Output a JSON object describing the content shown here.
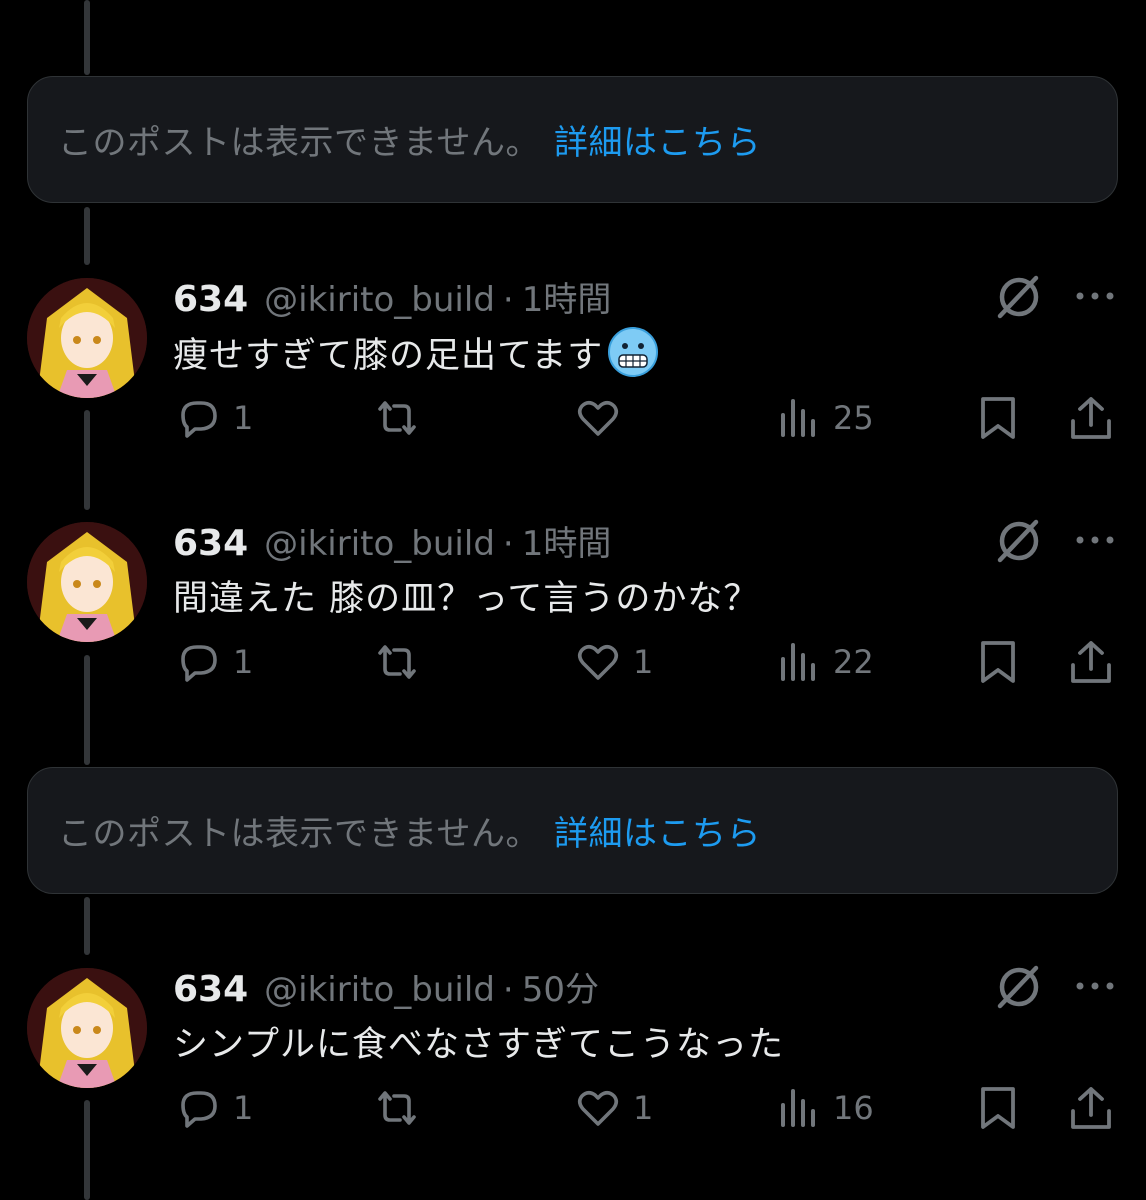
{
  "hidden_notice": {
    "text": "このポストは表示できません。",
    "link": "詳細はこちら"
  },
  "posts": [
    {
      "name": "634",
      "handle": "@ikirito_build",
      "separator": "·",
      "time": "1時間",
      "text": "痩せすぎて膝の足出てます",
      "emoji": "cold-face-emoji",
      "replies": "1",
      "reposts": "",
      "likes": "",
      "views": "25"
    },
    {
      "name": "634",
      "handle": "@ikirito_build",
      "separator": "·",
      "time": "1時間",
      "text": "間違えた 膝の皿？って言うのかな？",
      "replies": "1",
      "reposts": "",
      "likes": "1",
      "views": "22"
    },
    {
      "name": "634",
      "handle": "@ikirito_build",
      "separator": "·",
      "time": "50分",
      "text": "シンプルに食べなさすぎてこうなった",
      "replies": "1",
      "reposts": "",
      "likes": "1",
      "views": "16"
    }
  ],
  "icons": {
    "reply": "reply-icon",
    "repost": "repost-icon",
    "like": "heart-icon",
    "views": "views-icon",
    "bookmark": "bookmark-icon",
    "share": "share-icon",
    "grok": "grok-icon",
    "more": "more-icon"
  },
  "colors": {
    "background": "#000000",
    "link": "#1d9bf0",
    "muted": "#71767b",
    "text": "#e7e9ea",
    "card": "#16181c"
  }
}
